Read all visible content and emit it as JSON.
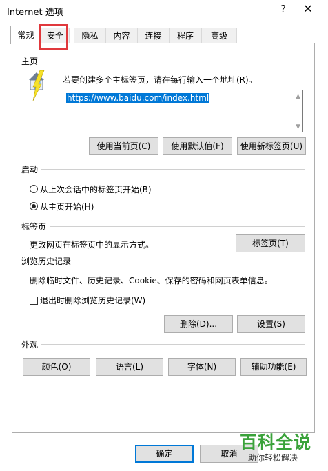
{
  "window": {
    "title": "Internet 选项",
    "help": "?",
    "close": "✕"
  },
  "tabs": [
    {
      "label": "常规",
      "active": true
    },
    {
      "label": "安全",
      "active": false
    },
    {
      "label": "隐私",
      "active": false
    },
    {
      "label": "内容",
      "active": false
    },
    {
      "label": "连接",
      "active": false
    },
    {
      "label": "程序",
      "active": false
    },
    {
      "label": "高级",
      "active": false
    }
  ],
  "home": {
    "title": "主页",
    "instruction": "若要创建多个主标签页，请在每行输入一个地址(R)。",
    "url": "https://www.baidu.com/index.html",
    "buttons": {
      "use_current": "使用当前页(C)",
      "use_default": "使用默认值(F)",
      "use_new_tab": "使用新标签页(U)"
    }
  },
  "startup": {
    "title": "启动",
    "options": [
      {
        "label": "从上次会话中的标签页开始(B)",
        "selected": false
      },
      {
        "label": "从主页开始(H)",
        "selected": true
      }
    ]
  },
  "tabs_section": {
    "title": "标签页",
    "description": "更改网页在标签页中的显示方式。",
    "button": "标签页(T)"
  },
  "history": {
    "title": "浏览历史记录",
    "description": "删除临时文件、历史记录、Cookie、保存的密码和网页表单信息。",
    "checkbox_label": "退出时删除浏览历史记录(W)",
    "checkbox_checked": false,
    "buttons": {
      "delete": "删除(D)...",
      "settings": "设置(S)"
    }
  },
  "appearance": {
    "title": "外观",
    "buttons": {
      "colors": "颜色(O)",
      "languages": "语言(L)",
      "fonts": "字体(N)",
      "accessibility": "辅助功能(E)"
    }
  },
  "footer": {
    "ok": "确定",
    "cancel": "取消"
  },
  "watermark": {
    "main": "百科全说",
    "sub": "助你轻松解决"
  },
  "colors": {
    "highlight_border": "#e0383c",
    "selection": "#0078d7",
    "watermark_green": "#3aa23a"
  }
}
